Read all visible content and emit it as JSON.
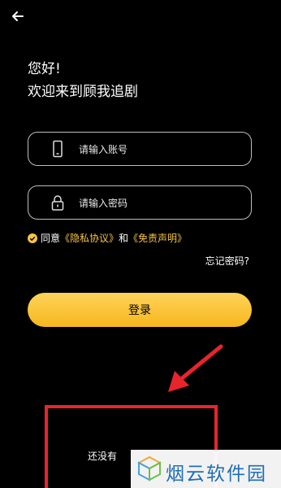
{
  "header": {
    "back_icon": "back-arrow-icon"
  },
  "greeting": {
    "line1": "您好!",
    "line2": "欢迎来到顾我追剧"
  },
  "account_field": {
    "placeholder": "请输入账号",
    "icon": "phone-icon"
  },
  "password_field": {
    "placeholder": "请输入密码",
    "icon": "lock-icon"
  },
  "agreement": {
    "prefix": "同意",
    "privacy": "《隐私协议》",
    "and": "和",
    "disclaimer": "《免责声明》"
  },
  "forgot_password": "忘记密码?",
  "login_button": "登录",
  "signup_prompt": "还没有",
  "watermark": "烟云软件园",
  "colors": {
    "accent": "#f6c343",
    "highlight": "#e8242c"
  }
}
